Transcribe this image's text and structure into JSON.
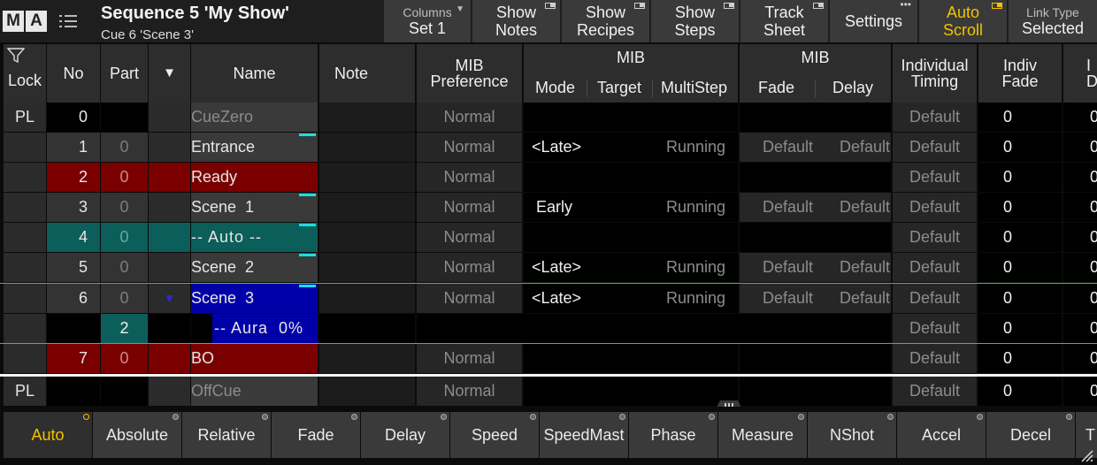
{
  "title_bar": {
    "logo_m": "M",
    "logo_a": "A",
    "sequence_title": "Sequence 5 'My Show'",
    "cue_subtitle": "Cue 6 'Scene 3'",
    "buttons": {
      "columns_label": "Columns",
      "columns_value": "Set 1",
      "show_notes_1": "Show",
      "show_notes_2": "Notes",
      "show_recipes_1": "Show",
      "show_recipes_2": "Recipes",
      "show_steps_1": "Show",
      "show_steps_2": "Steps",
      "track_sheet_1": "Track",
      "track_sheet_2": "Sheet",
      "settings": "Settings",
      "auto_scroll_1": "Auto",
      "auto_scroll_2": "Scroll",
      "link_type_label": "Link Type",
      "link_type_value": "Selected"
    },
    "accent_color": "#f2c200"
  },
  "columns": {
    "lock": "Lock",
    "no": "No",
    "part": "Part",
    "sort_icon": "▼",
    "name": "Name",
    "note": "Note",
    "mib_preference_1": "MIB",
    "mib_preference_2": "Preference",
    "mib_group_1": "MIB",
    "mode": "Mode",
    "target": "Target",
    "multistep": "MultiStep",
    "mib_group_2": "MIB",
    "fade": "Fade",
    "delay": "Delay",
    "individual_timing_1": "Individual",
    "individual_timing_2": "Timing",
    "indiv_fade_1": "Indiv",
    "indiv_fade_2": "Fade",
    "indiv_delay_1": "I",
    "indiv_delay_2": "D"
  },
  "rows": [
    {
      "lock": "PL",
      "no": "0",
      "part": "",
      "name": "CueZero",
      "pref": "Normal",
      "mode": "",
      "running": "",
      "fade": "",
      "delay": "",
      "indt": "Default",
      "ifade": "0",
      "idel": "0"
    },
    {
      "lock": "",
      "no": "1",
      "part": "0",
      "name": "Entrance",
      "pref": "Normal",
      "mode": "<Late>",
      "running": "Running",
      "fade": "Default",
      "delay": "Default",
      "indt": "Default",
      "ifade": "0",
      "idel": "0"
    },
    {
      "lock": "",
      "no": "2",
      "part": "0",
      "name": "Ready",
      "pref": "Normal",
      "mode": "",
      "running": "",
      "fade": "",
      "delay": "",
      "indt": "Default",
      "ifade": "0",
      "idel": "0"
    },
    {
      "lock": "",
      "no": "3",
      "part": "0",
      "name": "Scene  1",
      "pref": "Normal",
      "mode": " Early",
      "running": "Running",
      "fade": "Default",
      "delay": "Default",
      "indt": "Default",
      "ifade": "0",
      "idel": "0"
    },
    {
      "lock": "",
      "no": "4",
      "part": "0",
      "name": "-- Auto --",
      "pref": "Normal",
      "mode": "",
      "running": "",
      "fade": "",
      "delay": "",
      "indt": "Default",
      "ifade": "0",
      "idel": "0"
    },
    {
      "lock": "",
      "no": "5",
      "part": "0",
      "name": "Scene  2",
      "pref": "Normal",
      "mode": "<Late>",
      "running": "Running",
      "fade": "Default",
      "delay": "Default",
      "indt": "Default",
      "ifade": "0",
      "idel": "0"
    },
    {
      "lock": "",
      "no": "6",
      "part": "0",
      "arrow": "▼",
      "name": "Scene  3",
      "pref": "Normal",
      "mode": "<Late>",
      "running": "Running",
      "fade": "Default",
      "delay": "Default",
      "indt": "Default",
      "ifade": "0",
      "idel": "0"
    },
    {
      "lock": "",
      "no": "",
      "part": "2",
      "name": "-- Aura  0%",
      "pref": "",
      "mode": "",
      "running": "",
      "fade": "",
      "delay": "",
      "indt": "Default",
      "ifade": "0",
      "idel": "0"
    },
    {
      "lock": "",
      "no": "7",
      "part": "0",
      "name": "BO",
      "pref": "Normal",
      "mode": "",
      "running": "",
      "fade": "",
      "delay": "",
      "indt": "Default",
      "ifade": "0",
      "idel": "0"
    },
    {
      "lock": "PL",
      "no": "",
      "part": "",
      "name": "OffCue",
      "pref": "Normal",
      "mode": "",
      "running": "",
      "fade": "",
      "delay": "",
      "indt": "Default",
      "ifade": "0",
      "idel": "0"
    }
  ],
  "toolbar": {
    "auto": "Auto",
    "absolute": "Absolute",
    "relative": "Relative",
    "fade": "Fade",
    "delay": "Delay",
    "speed": "Speed",
    "speedmast": "SpeedMast",
    "phase": "Phase",
    "measure": "Measure",
    "nshot": "NShot",
    "accel": "Accel",
    "decel": "Decel",
    "t": "T"
  },
  "colors": {
    "cue_red": "#7a0000",
    "cue_teal": "#0c5e5a",
    "cue_selected_blue": "#0000a8",
    "cyan_marker": "#17e0e0",
    "current_cue_line": "#2bd12b"
  }
}
